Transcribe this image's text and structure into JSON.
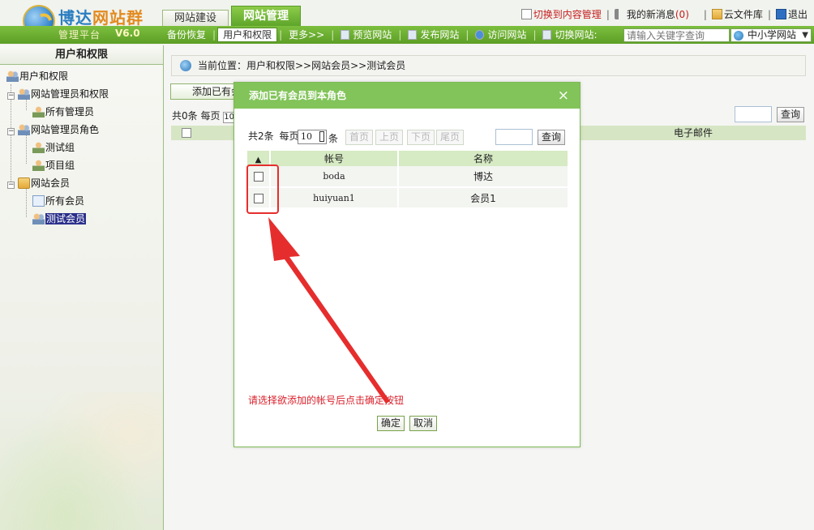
{
  "header": {
    "brand_prefix": "博达",
    "brand_suffix": "网站群",
    "subtitle": "管理平台",
    "version": "V6.0",
    "tabs": [
      {
        "label": "网站建设",
        "active": false
      },
      {
        "label": "网站管理",
        "active": true
      }
    ],
    "switch_link": "切换到内容管理",
    "messages_label": "我的新消息",
    "messages_count": "(0)",
    "cloud_label": "云文件库",
    "logout_label": "退出"
  },
  "nav": {
    "items": [
      "备份恢复",
      "用户和权限",
      "更多>>",
      "预览网站",
      "发布网站",
      "访问网站",
      "切换网站:"
    ],
    "active_index": 1,
    "search_placeholder": "请输入关键字查询",
    "site_select": "中小学网站"
  },
  "sidebar": {
    "title": "用户和权限",
    "tree": [
      {
        "label": "用户和权限"
      },
      {
        "label": "网站管理员和权限"
      },
      {
        "label": "所有管理员"
      },
      {
        "label": "网站管理员角色"
      },
      {
        "label": "测试组"
      },
      {
        "label": "项目组"
      },
      {
        "label": "网站会员"
      },
      {
        "label": "所有会员"
      },
      {
        "label": "测试会员",
        "selected": true
      }
    ]
  },
  "main": {
    "breadcrumb": "当前位置：用户和权限>>网站会员>>测试会员",
    "add_button": "添加已有会员",
    "pager_prefix": "共0条 每页",
    "pager_size": "10",
    "search_button": "查询",
    "email_header": "电子邮件"
  },
  "modal": {
    "title": "添加已有会员到本角色",
    "close": "×",
    "pager": {
      "total": "共2条",
      "per_page": "每页",
      "size": "10",
      "unit": "条",
      "first": "首页",
      "prev": "上页",
      "next": "下页",
      "last": "尾页"
    },
    "search_button": "查询",
    "columns": {
      "sort": "▲",
      "account": "帐号",
      "name": "名称"
    },
    "rows": [
      {
        "account": "boda",
        "name": "博达"
      },
      {
        "account": "huiyuan1",
        "name": "会员1"
      }
    ],
    "hint": "请选择欲添加的帐号后点击确定按钮",
    "ok": "确定",
    "cancel": "取消"
  },
  "colors": {
    "accent_green": "#82c45a",
    "nav_green": "#6aad33",
    "annotation_red": "#e62d2d"
  }
}
